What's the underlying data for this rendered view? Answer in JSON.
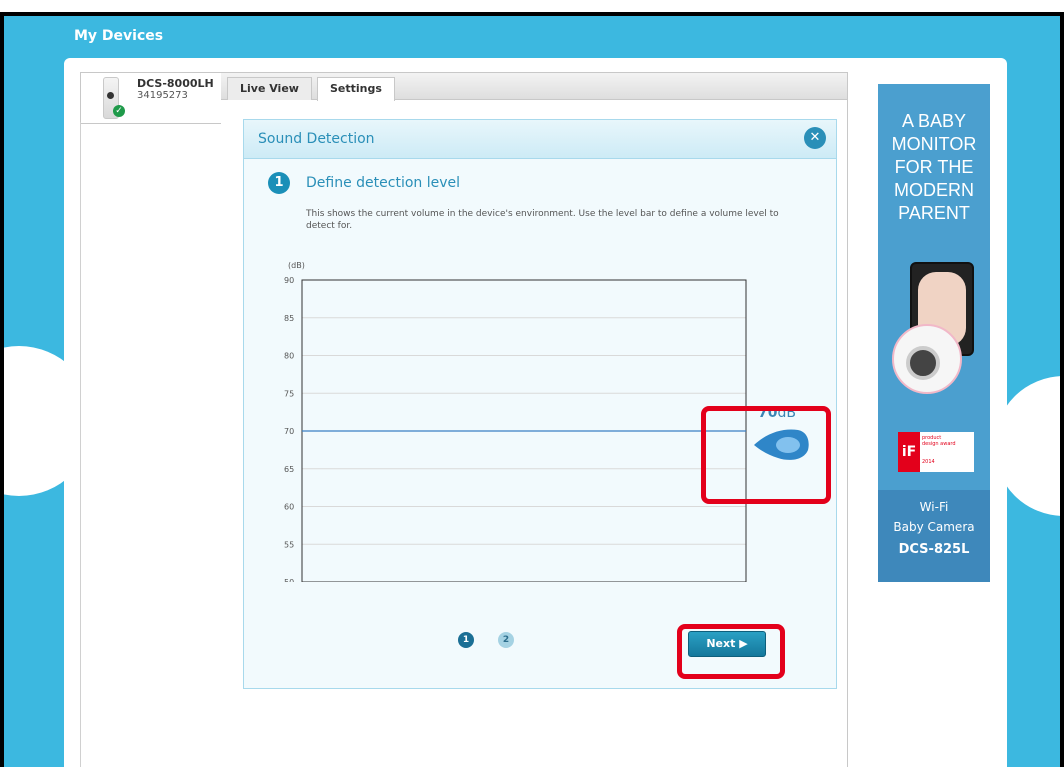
{
  "app": {
    "title": "My Devices"
  },
  "device": {
    "name": "DCS-8000LH",
    "id": "34195273"
  },
  "tabs": [
    {
      "label": "Live View",
      "active": false
    },
    {
      "label": "Settings",
      "active": true
    }
  ],
  "dialog": {
    "title": "Sound Detection",
    "step_number": "1",
    "step_title": "Define detection level",
    "step_description": "This shows the current volume in the device's environment. Use the level bar to define a volume level to detect for."
  },
  "level": {
    "value": "70",
    "unit": "dB"
  },
  "pager": {
    "pages": [
      "1",
      "2"
    ],
    "current": "1"
  },
  "next_button": {
    "label": "Next"
  },
  "chart_data": {
    "type": "line",
    "ylabel": "(dB)",
    "ylim": [
      50,
      90
    ],
    "yticks": [
      "90",
      "85",
      "80",
      "75",
      "70",
      "65",
      "60",
      "55",
      "50"
    ],
    "threshold": 70,
    "grid": true
  },
  "ad": {
    "headline_lines": [
      "A BABY",
      "MONITOR",
      "FOR THE",
      "MODERN",
      "PARENT"
    ],
    "footer_line1": "Wi-Fi",
    "footer_line2": "Baby Camera",
    "footer_model": "DCS-825L"
  },
  "colors": {
    "accent": "#2a8fb8",
    "highlight": "#e3001b",
    "background": "#3cb8e0"
  }
}
